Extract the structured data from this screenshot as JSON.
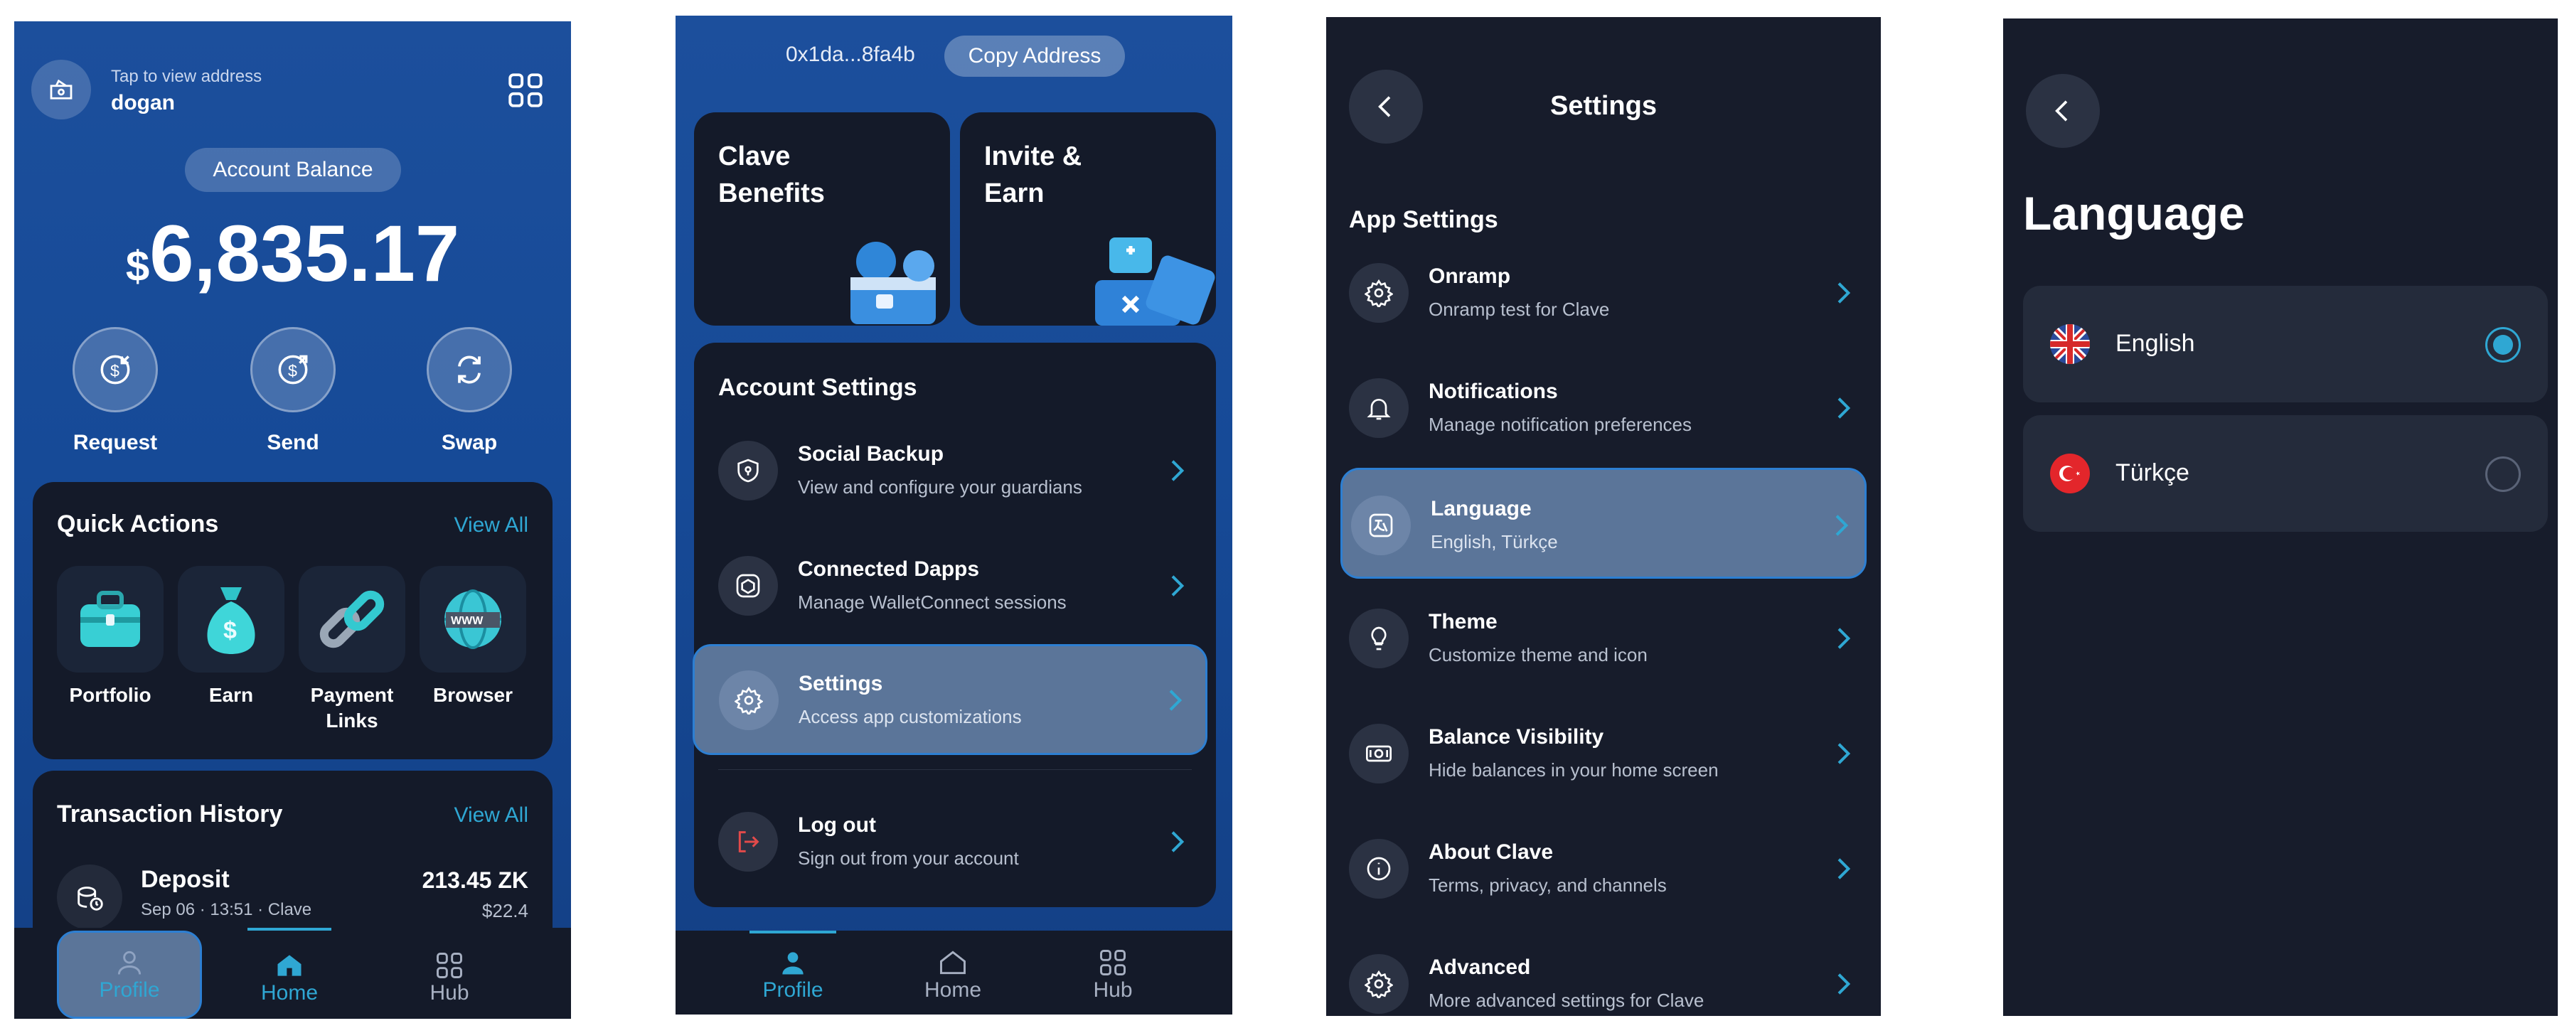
{
  "home": {
    "tap_hint": "Tap to view address",
    "username": "dogan",
    "balance_label": "Account Balance",
    "currency_symbol": "$",
    "balance": "6,835.17",
    "actions": [
      {
        "label": "Request",
        "icon": "request-icon"
      },
      {
        "label": "Send",
        "icon": "send-icon"
      },
      {
        "label": "Swap",
        "icon": "swap-icon"
      }
    ],
    "quick_actions": {
      "title": "Quick Actions",
      "view_all": "View All",
      "items": [
        {
          "label": "Portfolio",
          "icon": "briefcase-icon"
        },
        {
          "label": "Earn",
          "icon": "money-bag-icon"
        },
        {
          "label": "Payment Links",
          "icon": "link-icon"
        },
        {
          "label": "Browser",
          "icon": "globe-icon"
        }
      ]
    },
    "transactions": {
      "title": "Transaction History",
      "view_all": "View All",
      "items": [
        {
          "title": "Deposit",
          "subtitle": "Sep 06 · 13:51 · Clave",
          "amount": "213.45 ZK",
          "fiat": "$22.4"
        }
      ]
    },
    "nav": [
      "Profile",
      "Home",
      "Hub"
    ]
  },
  "profile": {
    "address": "0x1da...8fa4b",
    "copy_label": "Copy Address",
    "promo": [
      {
        "title": "Clave Benefits"
      },
      {
        "title": "Invite & Earn"
      }
    ],
    "section_title": "Account Settings",
    "items": [
      {
        "title": "Social Backup",
        "subtitle": "View and configure your guardians",
        "icon": "shield-icon"
      },
      {
        "title": "Connected Dapps",
        "subtitle": "Manage WalletConnect sessions",
        "icon": "cube-icon"
      },
      {
        "title": "Settings",
        "subtitle": "Access app customizations",
        "icon": "gear-icon"
      },
      {
        "title": "Log out",
        "subtitle": "Sign out from your account",
        "icon": "logout-icon"
      }
    ],
    "nav": [
      "Profile",
      "Home",
      "Hub"
    ]
  },
  "settings": {
    "title": "Settings",
    "section_title": "App Settings",
    "items": [
      {
        "title": "Onramp",
        "subtitle": "Onramp test for Clave",
        "icon": "gear-icon"
      },
      {
        "title": "Notifications",
        "subtitle": "Manage notification preferences",
        "icon": "bell-icon"
      },
      {
        "title": "Language",
        "subtitle": "English, Türkçe",
        "icon": "translate-icon"
      },
      {
        "title": "Theme",
        "subtitle": "Customize theme and icon",
        "icon": "lightbulb-icon"
      },
      {
        "title": "Balance Visibility",
        "subtitle": "Hide balances in your home screen",
        "icon": "cash-icon"
      },
      {
        "title": "About Clave",
        "subtitle": "Terms, privacy, and channels",
        "icon": "info-icon"
      },
      {
        "title": "Advanced",
        "subtitle": "More advanced settings for Clave",
        "icon": "gear-icon"
      }
    ]
  },
  "language": {
    "title": "Language",
    "options": [
      {
        "label": "English",
        "flag": "uk-flag-icon",
        "selected": true
      },
      {
        "label": "Türkçe",
        "flag": "turkey-flag-icon",
        "selected": false
      }
    ]
  },
  "colors": {
    "accent": "#2fa7d3",
    "highlight": "#5b7599",
    "card": "#141a29",
    "blue_bg": "#164a97"
  }
}
